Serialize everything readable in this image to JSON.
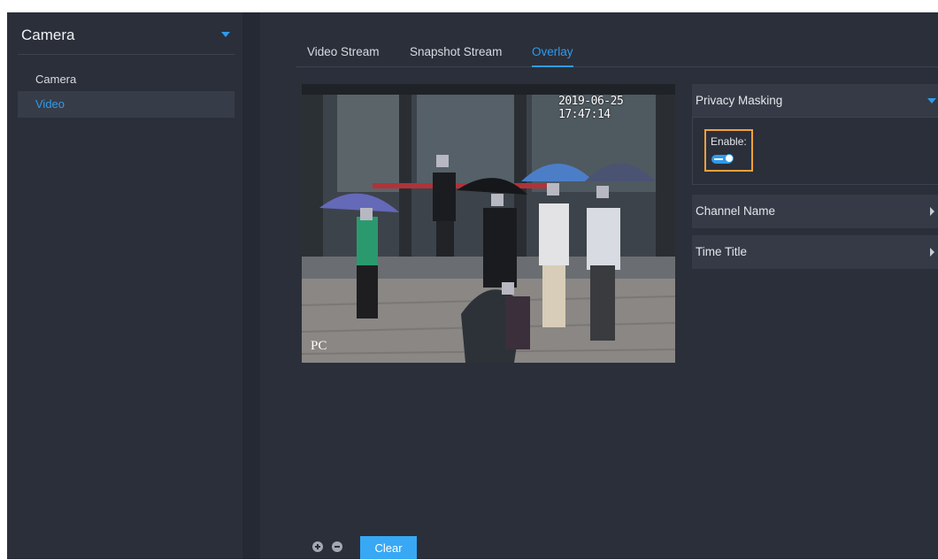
{
  "sidebar": {
    "title": "Camera",
    "items": [
      {
        "label": "Camera",
        "active": false
      },
      {
        "label": "Video",
        "active": true
      }
    ]
  },
  "tabs": [
    {
      "label": "Video Stream",
      "active": false
    },
    {
      "label": "Snapshot Stream",
      "active": false
    },
    {
      "label": "Overlay",
      "active": true
    }
  ],
  "video": {
    "timestamp": "2019-06-25 17:47:14",
    "channel_label": "PC"
  },
  "panels": {
    "privacy_masking": {
      "label": "Privacy Masking",
      "expanded": true,
      "enable_label": "Enable:",
      "enabled": true
    },
    "channel_name": {
      "label": "Channel Name",
      "expanded": false
    },
    "time_title": {
      "label": "Time Title",
      "expanded": false
    }
  },
  "footer": {
    "clear_label": "Clear"
  },
  "colors": {
    "accent": "#2f9bea",
    "highlight_border": "#f0a13a",
    "background": "#2b2f3a"
  }
}
